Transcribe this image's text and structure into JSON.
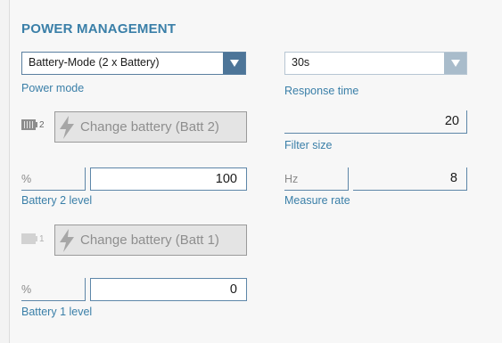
{
  "section_title": "POWER MANAGEMENT",
  "power_mode": {
    "value": "Battery-Mode (2 x Battery)",
    "label": "Power mode"
  },
  "response_time": {
    "value": "30s",
    "label": "Response time"
  },
  "batt2": {
    "index": "2",
    "button_label": "Change battery (Batt 2)"
  },
  "filter_size": {
    "value": "20",
    "label": "Filter size"
  },
  "battery2_level": {
    "unit": "%",
    "value": "100",
    "label": "Battery 2 level"
  },
  "measure_rate": {
    "unit": "Hz",
    "value": "8",
    "label": "Measure rate"
  },
  "batt1": {
    "index": "1",
    "button_label": "Change battery (Batt 1)"
  },
  "battery1_level": {
    "unit": "%",
    "value": "0",
    "label": "Battery 1 level"
  },
  "icons": {
    "battery": "battery-icon",
    "bolt": "lightning-bolt-icon",
    "dropdown": "chevron-down-icon"
  },
  "colors": {
    "accent": "#3a7fa8",
    "dropdown_button": "#4d7598",
    "dropdown_button_disabled": "#a9bccb"
  }
}
